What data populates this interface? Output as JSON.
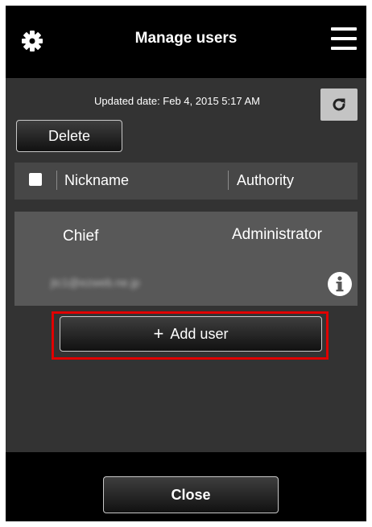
{
  "header": {
    "title": "Manage users",
    "left_icon": "gear-icon",
    "right_icon": "hamburger-menu-icon"
  },
  "toolbar": {
    "updated_text": "Updated date: Feb 4, 2015 5:17 AM",
    "refresh_icon": "refresh-icon",
    "delete_label": "Delete"
  },
  "table": {
    "columns": [
      "Nickname",
      "Authority"
    ],
    "rows": [
      {
        "nickname": "Chief",
        "authority": "Administrator",
        "email": "jtc1@ezweb.ne.jp"
      }
    ]
  },
  "actions": {
    "add_user_label": "Add user",
    "add_user_icon": "plus-icon"
  },
  "footer": {
    "close_label": "Close"
  },
  "colors": {
    "header_bg": "#000000",
    "body_bg": "#333333",
    "row_bg": "#585858",
    "highlight": "#e00000"
  }
}
